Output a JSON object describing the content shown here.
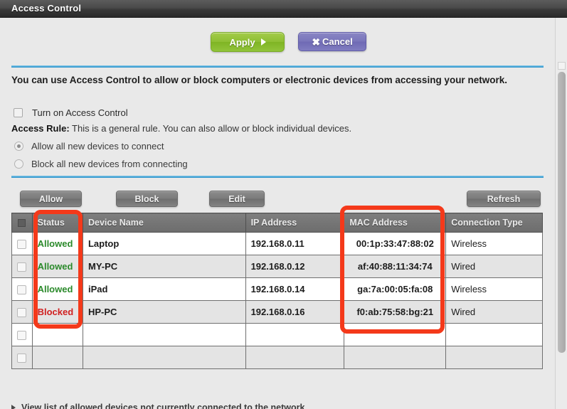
{
  "window": {
    "title": "Access Control"
  },
  "toolbar": {
    "apply_label": "Apply",
    "cancel_label": "Cancel",
    "apply_icon": "play-triangle-icon",
    "cancel_icon": "close-x-icon"
  },
  "description": {
    "paragraph": "You can use Access Control to allow or block computers or electronic devices from accessing your network.",
    "turn_on_label": "Turn on Access Control",
    "turn_on_checked": false,
    "access_rule_bold": "Access Rule:",
    "access_rule_text": " This is a general rule. You can also allow or block individual devices.",
    "radios": [
      {
        "label": "Allow all new devices to connect",
        "selected": true
      },
      {
        "label": "Block all new devices from connecting",
        "selected": false
      }
    ]
  },
  "actions": {
    "allow_label": "Allow",
    "block_label": "Block",
    "edit_label": "Edit",
    "refresh_label": "Refresh"
  },
  "table": {
    "headers": {
      "status": "Status",
      "device_name": "Device Name",
      "ip_address": "IP Address",
      "mac_address": "MAC Address",
      "connection_type": "Connection Type"
    },
    "rows": [
      {
        "status": "Allowed",
        "status_state": "allowed",
        "device_name": "Laptop",
        "ip_address": "192.168.0.11",
        "mac_address": "00:1p:33:47:88:02",
        "connection_type": "Wireless"
      },
      {
        "status": "Allowed",
        "status_state": "allowed",
        "device_name": "MY-PC",
        "ip_address": "192.168.0.12",
        "mac_address": "af:40:88:11:34:74",
        "connection_type": "Wired"
      },
      {
        "status": "Allowed",
        "status_state": "allowed",
        "device_name": "iPad",
        "ip_address": "192.168.0.14",
        "mac_address": "ga:7a:00:05:fa:08",
        "connection_type": "Wireless"
      },
      {
        "status": "Blocked",
        "status_state": "blocked",
        "device_name": "HP-PC",
        "ip_address": "192.168.0.16",
        "mac_address": "f0:ab:75:58:bg:21",
        "connection_type": "Wired"
      },
      {
        "status": "",
        "status_state": "empty",
        "device_name": "",
        "ip_address": "",
        "mac_address": "",
        "connection_type": ""
      },
      {
        "status": "",
        "status_state": "empty",
        "device_name": "",
        "ip_address": "",
        "mac_address": "",
        "connection_type": ""
      }
    ]
  },
  "footer": {
    "link_label": "View list of allowed devices not currently connected to the network"
  },
  "annotations": {
    "highlight_color": "#f4391a",
    "boxes": [
      "status-column-highlight",
      "mac-address-column-highlight"
    ]
  },
  "colors": {
    "apply_green": "#8dbf33",
    "cancel_purple": "#7a76bb",
    "accent_blue": "#4aa8d8",
    "allowed_green": "#2b8a2b",
    "blocked_red": "#d02020",
    "titlebar_dark": "#3a3a3a"
  }
}
